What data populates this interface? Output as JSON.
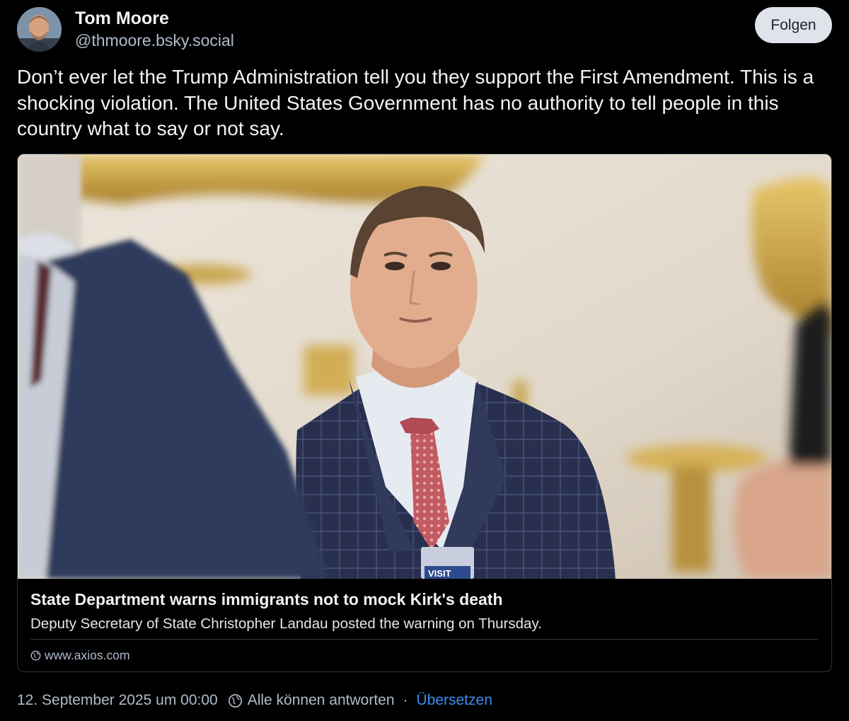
{
  "post": {
    "author": {
      "name": "Tom Moore",
      "handle": "@thmoore.bsky.social"
    },
    "follow_label": "Folgen",
    "text": "Don’t ever let the Trump Administration tell you they support the First Amendment. This is a shocking violation. The United States Government has no authority to tell people in this country what to say or not say.",
    "link_card": {
      "image_badge_text": "VISIT",
      "title": "State Department warns immigrants not to mock Kirk's death",
      "description": "Deputy Secretary of State Christopher Landau posted the warning on Thursday.",
      "source": "www.axios.com"
    },
    "footer": {
      "timestamp": "12. September 2025 um 00:00",
      "reply_setting": "Alle können antworten",
      "separator": "·",
      "translate_label": "Übersetzen"
    }
  },
  "icons": {
    "reply_setting": "globe-icon",
    "source": "globe-icon"
  },
  "colors": {
    "background": "#000000",
    "text_primary": "#f1f3f5",
    "text_secondary": "#aebbc9",
    "link": "#3d8cf0",
    "follow_button_bg": "#dfe4ea",
    "card_border": "#2c3540"
  }
}
